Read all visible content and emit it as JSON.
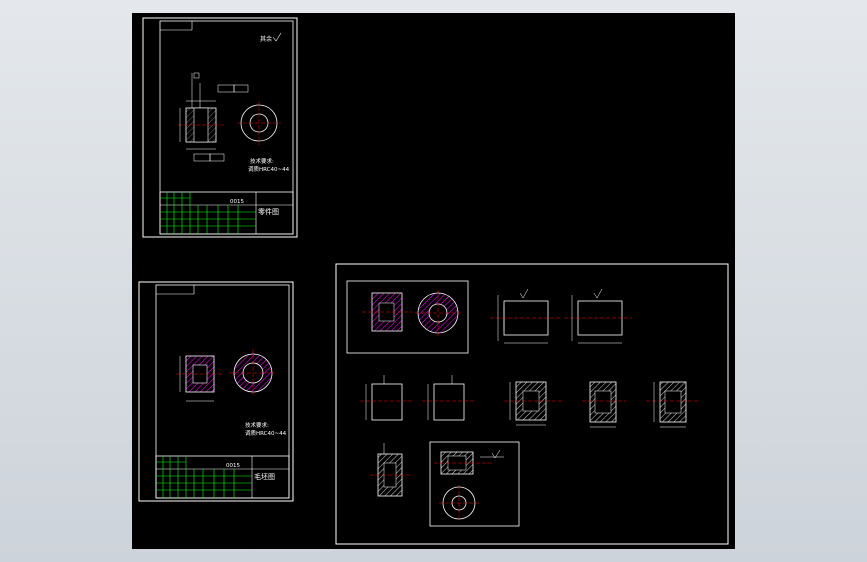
{
  "app": {
    "background": "#000000",
    "line_color": "#ffffff",
    "title_block_color": "#00ff00",
    "centerline_color": "#ff0000",
    "hatch_color": "#ff00ff"
  },
  "sheet_top_left": {
    "roughness_note": "其余",
    "tech_req_label": "技术要求:",
    "tech_req_text": "调质HRC40~44",
    "drawing_number": "0015",
    "part_name": "零件图"
  },
  "sheet_bottom_left": {
    "tech_req_label": "技术要求:",
    "tech_req_text": "调质HRC40~44",
    "drawing_number": "0015",
    "part_name": "毛坯图"
  },
  "process_sheet": {
    "steps": [
      {
        "id": "blank"
      },
      {
        "id": "op1"
      },
      {
        "id": "op2"
      },
      {
        "id": "op3"
      },
      {
        "id": "op4"
      },
      {
        "id": "op5"
      },
      {
        "id": "op6"
      },
      {
        "id": "op7"
      },
      {
        "id": "op8"
      },
      {
        "id": "final"
      }
    ]
  },
  "icons": {
    "roughness": "roughness-symbol-icon",
    "datum": "datum-symbol-icon"
  }
}
